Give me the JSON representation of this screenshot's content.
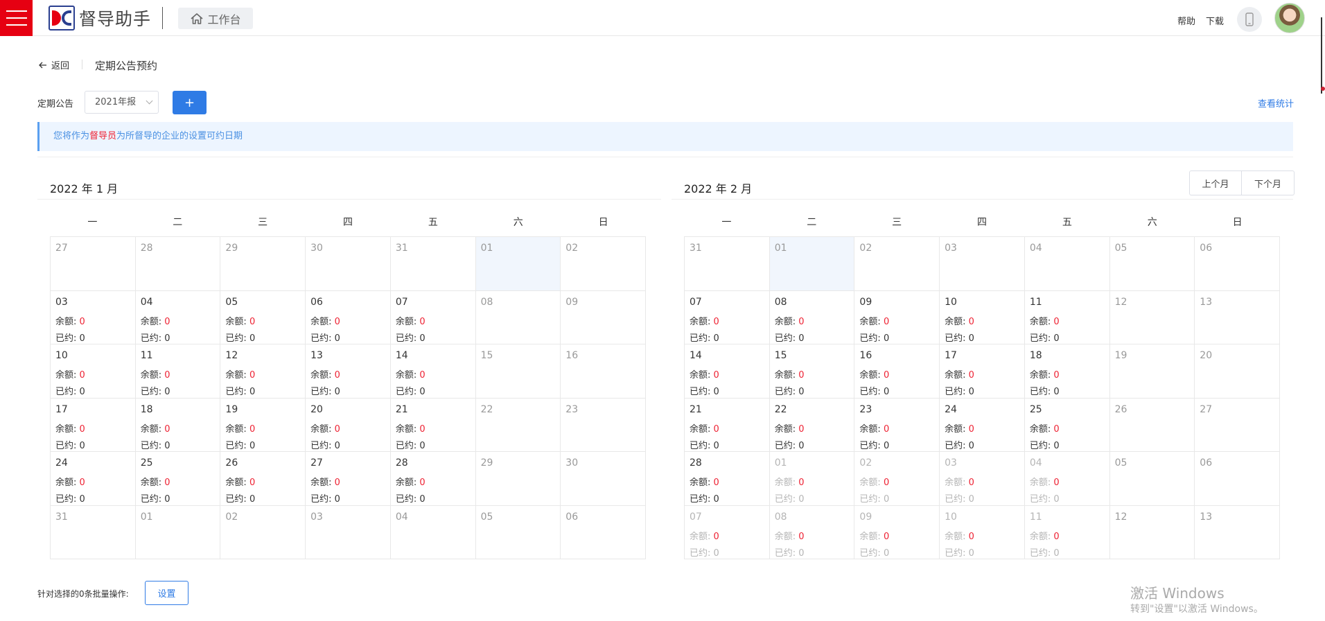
{
  "app": {
    "title": "督导助手",
    "workbench": "工作台",
    "help": "帮助",
    "download": "下载"
  },
  "header": {
    "back": "返回",
    "title": "定期公告预约"
  },
  "filter": {
    "label": "定期公告",
    "selected": "2021年报",
    "add": "+",
    "stats": "查看统计"
  },
  "notice": {
    "prefix": "您将作为",
    "role": "督导员",
    "suffix": "为所督导的企业的设置可约日期"
  },
  "nav": {
    "prev": "上个月",
    "next": "下个月"
  },
  "weekdays": [
    "一",
    "二",
    "三",
    "四",
    "五",
    "六",
    "日"
  ],
  "labels": {
    "quota": "余额: ",
    "booked": "已约: "
  },
  "calendars": [
    {
      "title": "2022 年 1 月",
      "cells": [
        {
          "day": "27",
          "state": "muted"
        },
        {
          "day": "28",
          "state": "muted"
        },
        {
          "day": "29",
          "state": "muted"
        },
        {
          "day": "30",
          "state": "muted"
        },
        {
          "day": "31",
          "state": "muted"
        },
        {
          "day": "01",
          "state": "today"
        },
        {
          "day": "02",
          "state": "muted"
        },
        {
          "day": "03",
          "state": "work",
          "quota": "0",
          "booked": "0"
        },
        {
          "day": "04",
          "state": "work",
          "quota": "0",
          "booked": "0"
        },
        {
          "day": "05",
          "state": "work",
          "quota": "0",
          "booked": "0"
        },
        {
          "day": "06",
          "state": "work",
          "quota": "0",
          "booked": "0"
        },
        {
          "day": "07",
          "state": "work",
          "quota": "0",
          "booked": "0"
        },
        {
          "day": "08",
          "state": "muted"
        },
        {
          "day": "09",
          "state": "muted"
        },
        {
          "day": "10",
          "state": "work",
          "quota": "0",
          "booked": "0"
        },
        {
          "day": "11",
          "state": "work",
          "quota": "0",
          "booked": "0"
        },
        {
          "day": "12",
          "state": "work",
          "quota": "0",
          "booked": "0"
        },
        {
          "day": "13",
          "state": "work",
          "quota": "0",
          "booked": "0"
        },
        {
          "day": "14",
          "state": "work",
          "quota": "0",
          "booked": "0"
        },
        {
          "day": "15",
          "state": "muted"
        },
        {
          "day": "16",
          "state": "muted"
        },
        {
          "day": "17",
          "state": "work",
          "quota": "0",
          "booked": "0"
        },
        {
          "day": "18",
          "state": "work",
          "quota": "0",
          "booked": "0"
        },
        {
          "day": "19",
          "state": "work",
          "quota": "0",
          "booked": "0"
        },
        {
          "day": "20",
          "state": "work",
          "quota": "0",
          "booked": "0"
        },
        {
          "day": "21",
          "state": "work",
          "quota": "0",
          "booked": "0"
        },
        {
          "day": "22",
          "state": "muted"
        },
        {
          "day": "23",
          "state": "muted"
        },
        {
          "day": "24",
          "state": "work",
          "quota": "0",
          "booked": "0"
        },
        {
          "day": "25",
          "state": "work",
          "quota": "0",
          "booked": "0"
        },
        {
          "day": "26",
          "state": "work",
          "quota": "0",
          "booked": "0"
        },
        {
          "day": "27",
          "state": "work",
          "quota": "0",
          "booked": "0"
        },
        {
          "day": "28",
          "state": "work",
          "quota": "0",
          "booked": "0"
        },
        {
          "day": "29",
          "state": "muted"
        },
        {
          "day": "30",
          "state": "muted"
        },
        {
          "day": "31",
          "state": "muted"
        },
        {
          "day": "01",
          "state": "muted"
        },
        {
          "day": "02",
          "state": "muted"
        },
        {
          "day": "03",
          "state": "muted"
        },
        {
          "day": "04",
          "state": "muted"
        },
        {
          "day": "05",
          "state": "muted"
        },
        {
          "day": "06",
          "state": "muted"
        }
      ]
    },
    {
      "title": "2022 年 2 月",
      "cells": [
        {
          "day": "31",
          "state": "muted"
        },
        {
          "day": "01",
          "state": "today"
        },
        {
          "day": "02",
          "state": "muted"
        },
        {
          "day": "03",
          "state": "muted"
        },
        {
          "day": "04",
          "state": "muted"
        },
        {
          "day": "05",
          "state": "muted"
        },
        {
          "day": "06",
          "state": "muted"
        },
        {
          "day": "07",
          "state": "work",
          "quota": "0",
          "booked": "0"
        },
        {
          "day": "08",
          "state": "work",
          "quota": "0",
          "booked": "0"
        },
        {
          "day": "09",
          "state": "work",
          "quota": "0",
          "booked": "0"
        },
        {
          "day": "10",
          "state": "work",
          "quota": "0",
          "booked": "0"
        },
        {
          "day": "11",
          "state": "work",
          "quota": "0",
          "booked": "0"
        },
        {
          "day": "12",
          "state": "muted"
        },
        {
          "day": "13",
          "state": "muted"
        },
        {
          "day": "14",
          "state": "work",
          "quota": "0",
          "booked": "0"
        },
        {
          "day": "15",
          "state": "work",
          "quota": "0",
          "booked": "0"
        },
        {
          "day": "16",
          "state": "work",
          "quota": "0",
          "booked": "0"
        },
        {
          "day": "17",
          "state": "work",
          "quota": "0",
          "booked": "0"
        },
        {
          "day": "18",
          "state": "work",
          "quota": "0",
          "booked": "0"
        },
        {
          "day": "19",
          "state": "muted"
        },
        {
          "day": "20",
          "state": "muted"
        },
        {
          "day": "21",
          "state": "work",
          "quota": "0",
          "booked": "0"
        },
        {
          "day": "22",
          "state": "work",
          "quota": "0",
          "booked": "0"
        },
        {
          "day": "23",
          "state": "work",
          "quota": "0",
          "booked": "0"
        },
        {
          "day": "24",
          "state": "work",
          "quota": "0",
          "booked": "0"
        },
        {
          "day": "25",
          "state": "work",
          "quota": "0",
          "booked": "0"
        },
        {
          "day": "26",
          "state": "muted"
        },
        {
          "day": "27",
          "state": "muted"
        },
        {
          "day": "28",
          "state": "work",
          "quota": "0",
          "booked": "0"
        },
        {
          "day": "01",
          "state": "faded",
          "quota": "0",
          "booked": "0"
        },
        {
          "day": "02",
          "state": "faded",
          "quota": "0",
          "booked": "0"
        },
        {
          "day": "03",
          "state": "faded",
          "quota": "0",
          "booked": "0"
        },
        {
          "day": "04",
          "state": "faded",
          "quota": "0",
          "booked": "0"
        },
        {
          "day": "05",
          "state": "muted"
        },
        {
          "day": "06",
          "state": "muted"
        },
        {
          "day": "07",
          "state": "faded",
          "quota": "0",
          "booked": "0"
        },
        {
          "day": "08",
          "state": "faded",
          "quota": "0",
          "booked": "0"
        },
        {
          "day": "09",
          "state": "faded",
          "quota": "0",
          "booked": "0"
        },
        {
          "day": "10",
          "state": "faded",
          "quota": "0",
          "booked": "0"
        },
        {
          "day": "11",
          "state": "faded",
          "quota": "0",
          "booked": "0"
        },
        {
          "day": "12",
          "state": "muted"
        },
        {
          "day": "13",
          "state": "muted"
        }
      ]
    }
  ],
  "batch": {
    "label": "针对选择的0条批量操作:",
    "button": "设置"
  },
  "watermark": {
    "line1": "激活 Windows",
    "line2": "转到\"设置\"以激活 Windows。"
  },
  "colors": {
    "brand_red": "#e60012",
    "primary_blue": "#2f7be5",
    "notice_bg": "#edf5ff",
    "quota_red": "#e22233"
  }
}
